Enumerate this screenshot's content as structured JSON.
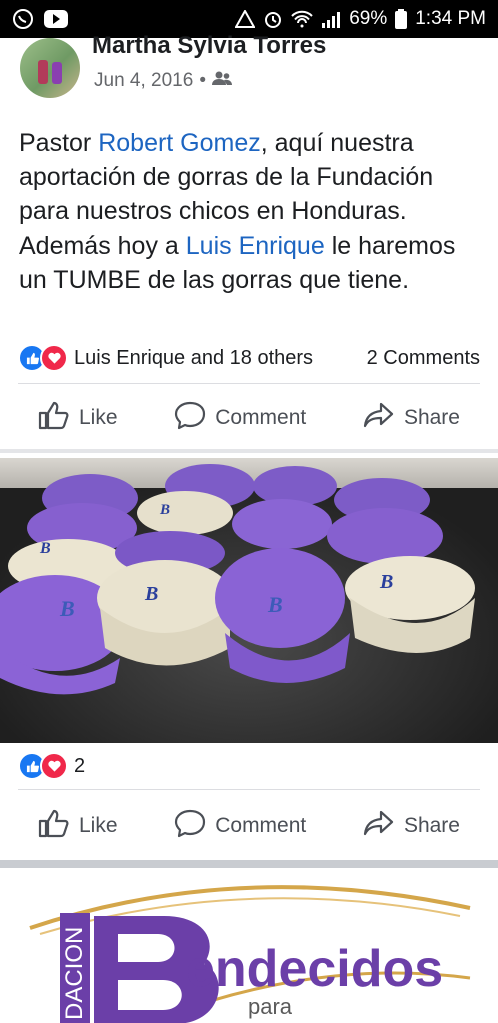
{
  "status_bar": {
    "battery": "69%",
    "time": "1:34 PM",
    "icons": [
      "whatsapp-icon",
      "youtube-icon",
      "warning-icon",
      "alarm-icon",
      "wifi-icon",
      "signal-icon",
      "battery-icon"
    ]
  },
  "post": {
    "author": "Martha Sylvia Torres",
    "date": "Jun 4, 2016",
    "separator": "•",
    "audience_icon": "friends-icon",
    "text": {
      "part1": "Pastor ",
      "mention1": "Robert Gomez",
      "part2": ", aquí nuestra aportación de gorras de la Fundación para nuestros chicos en Honduras. Además hoy a ",
      "mention2": "Luis Enrique",
      "part3": " le haremos un TUMBE de las gorras que tiene."
    },
    "reactions": {
      "summary": "Luis Enrique and 18 others",
      "comments": "2 Comments"
    },
    "actions": {
      "like": "Like",
      "comment": "Comment",
      "share": "Share"
    }
  },
  "photo": {
    "reaction_count": "2",
    "actions": {
      "like": "Like",
      "comment": "Comment",
      "share": "Share"
    }
  },
  "banner": {
    "vertical_text": "DACION",
    "logo_text": "endecidos",
    "sub_text": "para"
  },
  "colors": {
    "like_blue": "#1877f2",
    "love_red": "#f0284a",
    "mention_blue": "#1d65c1",
    "purple": "#6b3fa8"
  }
}
